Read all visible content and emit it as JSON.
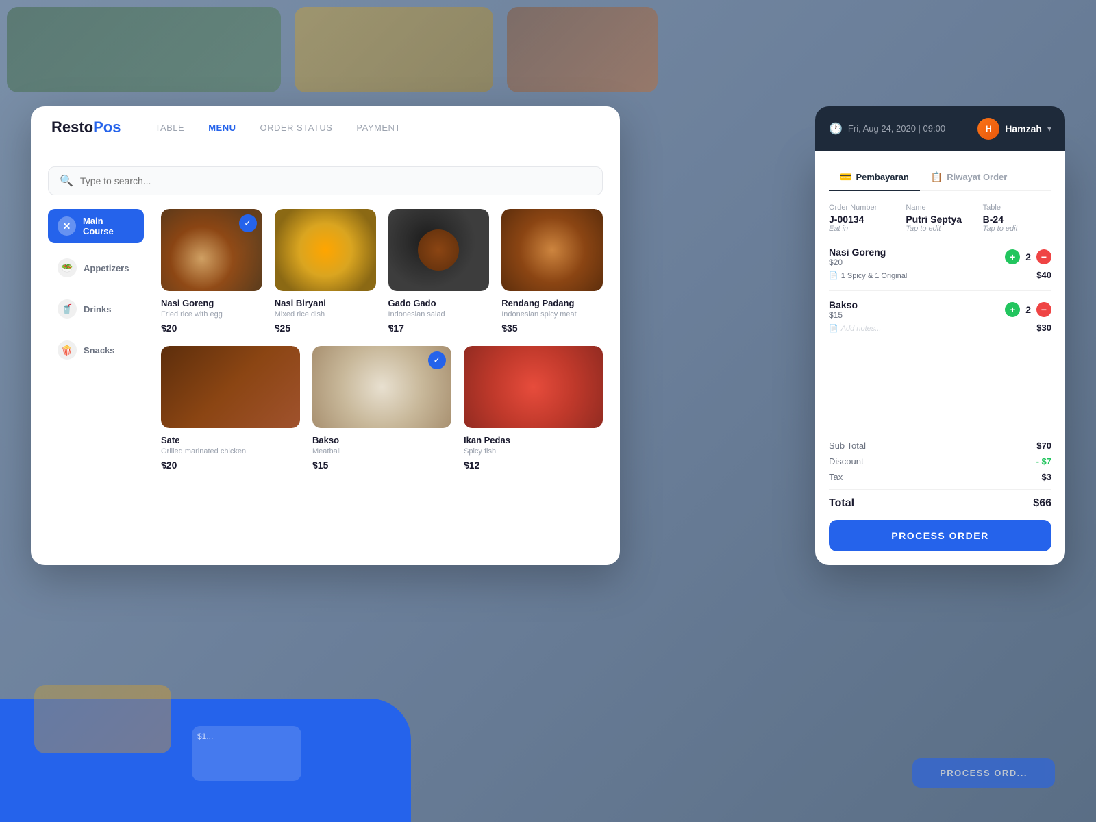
{
  "app": {
    "logo_part1": "Resto",
    "logo_part2": "Pos"
  },
  "nav": {
    "links": [
      {
        "label": "TABLE",
        "active": false
      },
      {
        "label": "MENU",
        "active": true
      },
      {
        "label": "ORDER STATUS",
        "active": false
      },
      {
        "label": "PAYMENT",
        "active": false
      }
    ]
  },
  "header": {
    "datetime": "Fri, Aug 24, 2020 | 09:00",
    "user": "Hamzah",
    "clock_icon": "🕐"
  },
  "search": {
    "placeholder": "Type to search..."
  },
  "categories": [
    {
      "id": "main-course",
      "label": "Main Course",
      "icon": "✕",
      "active": true
    },
    {
      "id": "appetizers",
      "label": "Appetizers",
      "icon": "🥗",
      "active": false
    },
    {
      "id": "drinks",
      "label": "Drinks",
      "icon": "🥤",
      "active": false
    },
    {
      "id": "snacks",
      "label": "Snacks",
      "icon": "🍿",
      "active": false
    }
  ],
  "menu_items": [
    {
      "id": "nasi-goreng",
      "name": "Nasi Goreng",
      "desc": "Fried rice with egg",
      "price": "$20",
      "selected": true,
      "color_class": "food-nasigoreng",
      "emoji": "🍳"
    },
    {
      "id": "nasi-biryani",
      "name": "Nasi Biryani",
      "desc": "Mixed rice dish",
      "price": "$25",
      "selected": false,
      "color_class": "food-nasibiryani",
      "emoji": "🍛"
    },
    {
      "id": "gado-gado",
      "name": "Gado Gado",
      "desc": "Indonesian salad",
      "price": "$17",
      "selected": false,
      "color_class": "food-gadogado",
      "emoji": "🥗"
    },
    {
      "id": "rendang-padang",
      "name": "Rendang Padang",
      "desc": "Indonesian spicy meat",
      "price": "$35",
      "selected": false,
      "color_class": "food-rendangpadang",
      "emoji": "🍖"
    },
    {
      "id": "sate",
      "name": "Sate",
      "desc": "Grilled marinated chicken",
      "price": "$20",
      "selected": false,
      "color_class": "food-sate",
      "emoji": "🍢"
    },
    {
      "id": "bakso",
      "name": "Bakso",
      "desc": "Meatball",
      "price": "$15",
      "selected": true,
      "color_class": "food-bakso",
      "emoji": "🍜"
    },
    {
      "id": "ikan-pedas",
      "name": "Ikan Pedas",
      "desc": "Spicy fish",
      "price": "$12",
      "selected": false,
      "color_class": "food-ikanpedas",
      "emoji": "🐟"
    }
  ],
  "order": {
    "tabs": [
      {
        "label": "Pembayaran",
        "active": true,
        "icon": "💳"
      },
      {
        "label": "Riwayat Order",
        "active": false,
        "icon": "📋"
      }
    ],
    "order_number_label": "Order Number",
    "order_number": "J-00134",
    "order_type": "Eat in",
    "name_label": "Name",
    "customer_name": "Putri Septya",
    "name_edit": "Tap to edit",
    "table_label": "Table",
    "table_number": "B-24",
    "table_edit": "Tap to edit",
    "items": [
      {
        "name": "Nasi Goreng",
        "unit_price": "$20",
        "quantity": 2,
        "note": "1 Spicy & 1 Original",
        "subtotal": "$40"
      },
      {
        "name": "Bakso",
        "unit_price": "$15",
        "quantity": 2,
        "note": "Add notes...",
        "subtotal": "$30"
      }
    ],
    "sub_total_label": "Sub Total",
    "sub_total": "$70",
    "discount_label": "Discount",
    "discount": "- $7",
    "tax_label": "Tax",
    "tax": "$3",
    "total_label": "Total",
    "total": "$66",
    "process_btn": "PROCESS ORDER"
  }
}
